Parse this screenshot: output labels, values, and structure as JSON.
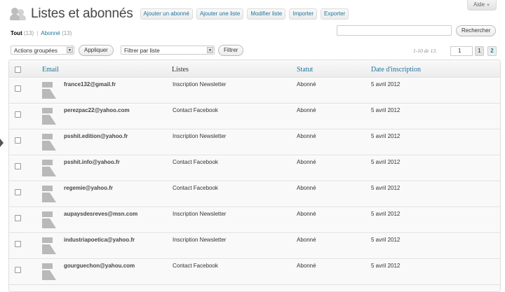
{
  "help": {
    "label": "Aide",
    "arrow": "▼"
  },
  "header": {
    "title": "Listes et abonnés",
    "buttons": [
      "Ajouter un abonné",
      "Ajouter une liste",
      "Modifier liste",
      "Importer",
      "Exporter"
    ]
  },
  "filters": {
    "all_label": "Tout",
    "all_count": "(13)",
    "separator": "|",
    "sub_label": "Abonné",
    "sub_count": "(13)"
  },
  "search": {
    "value": "",
    "button": "Rechercher"
  },
  "bulk": {
    "select_value": "Actions groupées",
    "apply_label": "Appliquer"
  },
  "list_filter": {
    "select_value": "Filtrer par liste",
    "button": "Filtrer"
  },
  "pagination": {
    "count_text": "1-10 de 13.",
    "page_input": "1",
    "current_page": "1",
    "next_page": "2"
  },
  "columns": {
    "email": "Email",
    "listes": "Listes",
    "statut": "Statut",
    "date": "Date d'inscription"
  },
  "rows": [
    {
      "email": "france132@gmail.fr",
      "liste": "Inscription Newsletter",
      "statut": "Abonné",
      "date": "5 avril 2012"
    },
    {
      "email": "perezpac22@yahoo.com",
      "liste": "Contact Facebook",
      "statut": "Abonné",
      "date": "5 avril 2012"
    },
    {
      "email": "psshit.edition@yahoo.fr",
      "liste": "Inscription Newsletter",
      "statut": "Abonné",
      "date": "5 avril 2012"
    },
    {
      "email": "psshit.info@yahoo.fr",
      "liste": "Contact Facebook",
      "statut": "Abonné",
      "date": "5 avril 2012"
    },
    {
      "email": "regemie@yahoo.fr",
      "liste": "Contact Facebook",
      "statut": "Abonné",
      "date": "5 avril 2012"
    },
    {
      "email": "aupaysdesreves@msn.com",
      "liste": "Inscription Newsletter",
      "statut": "Abonné",
      "date": "5 avril 2012"
    },
    {
      "email": "industriapoetica@yahoo.fr",
      "liste": "Inscription Newsletter",
      "statut": "Abonné",
      "date": "5 avril 2012"
    },
    {
      "email": "gourguechon@yahou.com",
      "liste": "Contact Facebook",
      "statut": "Abonné",
      "date": "5 avril 2012"
    }
  ],
  "colors": {
    "link": "#21759b",
    "border": "#dfdfdf",
    "row_bg": "#f9f9f9"
  }
}
